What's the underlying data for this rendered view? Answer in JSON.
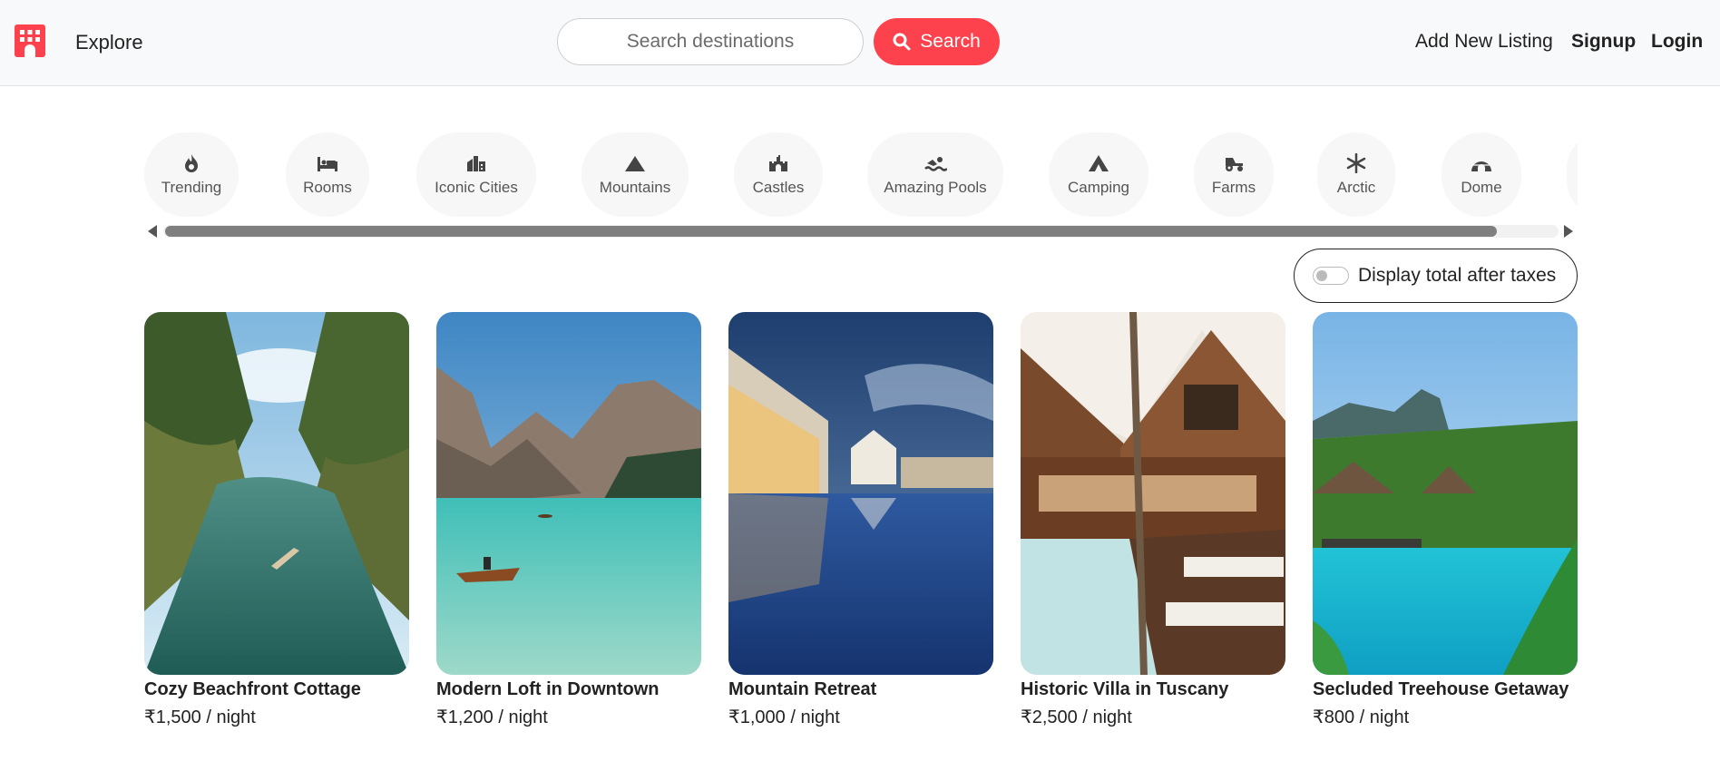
{
  "navbar": {
    "logo_icon": "building-icon",
    "brand_color": "#fe424d",
    "explore_label": "Explore",
    "search": {
      "placeholder": "Search destinations",
      "value": "",
      "button_label": "Search",
      "button_icon": "search-icon"
    },
    "add_listing_label": "Add New Listing",
    "signup_label": "Signup",
    "login_label": "Login"
  },
  "filters": [
    {
      "label": "Trending",
      "icon": "fire-icon"
    },
    {
      "label": "Rooms",
      "icon": "bed-icon"
    },
    {
      "label": "Iconic Cities",
      "icon": "city-icon"
    },
    {
      "label": "Mountains",
      "icon": "mountain-icon"
    },
    {
      "label": "Castles",
      "icon": "castle-icon"
    },
    {
      "label": "Amazing Pools",
      "icon": "swimmer-icon"
    },
    {
      "label": "Camping",
      "icon": "tent-icon"
    },
    {
      "label": "Farms",
      "icon": "tractor-icon"
    },
    {
      "label": "Arctic",
      "icon": "snowflake-icon"
    },
    {
      "label": "Dome",
      "icon": "igloo-icon"
    }
  ],
  "tax_toggle": {
    "label": "Display total after taxes",
    "enabled": false
  },
  "listings": [
    {
      "title": "Cozy Beachfront Cottage",
      "price": "₹1,500 / night",
      "image": "tropical-palm-lagoon-photo"
    },
    {
      "title": "Modern Loft in Downtown",
      "price": "₹1,200 / night",
      "image": "mountain-lake-boat-photo"
    },
    {
      "title": "Mountain Retreat",
      "price": "₹1,000 / night",
      "image": "resort-pool-reflection-photo"
    },
    {
      "title": "Historic Villa in Tuscany",
      "price": "₹2,500 / night",
      "image": "wooden-lodge-pool-photo"
    },
    {
      "title": "Secluded Treehouse Getaway",
      "price": "₹800 / night",
      "image": "tropical-resort-pool-photo"
    }
  ]
}
